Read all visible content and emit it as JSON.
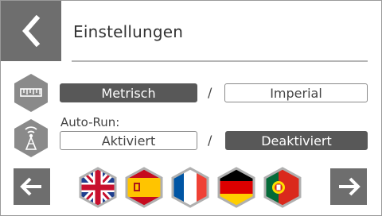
{
  "header": {
    "title": "Einstellungen",
    "back_icon": "chevron-left-icon"
  },
  "units": {
    "icon": "ruler-icon",
    "options": [
      "Metrisch",
      "Imperial"
    ],
    "selected": "Metrisch",
    "separator": "/"
  },
  "autorun": {
    "icon": "antenna-icon",
    "label": "Auto-Run:",
    "options": [
      "Aktiviert",
      "Deaktiviert"
    ],
    "selected": "Deaktiviert",
    "separator": "/"
  },
  "languages": {
    "prev_icon": "arrow-left-icon",
    "next_icon": "arrow-right-icon",
    "flags": [
      "flag-uk-icon",
      "flag-spain-icon",
      "flag-france-icon",
      "flag-germany-icon",
      "flag-portugal-icon"
    ]
  },
  "colors": {
    "button_dark": "#6e6e6e",
    "segment_active": "#585858",
    "hex_icon": "#8a8a8a"
  }
}
